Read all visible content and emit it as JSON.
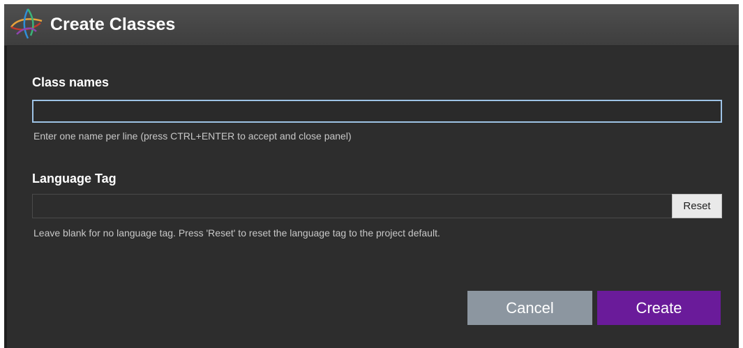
{
  "dialog": {
    "title": "Create Classes"
  },
  "class_names": {
    "label": "Class names",
    "value": "",
    "placeholder": "",
    "hint": "Enter one name per line (press CTRL+ENTER to accept and close panel)"
  },
  "language_tag": {
    "label": "Language Tag",
    "value": "",
    "placeholder": "",
    "reset_label": "Reset",
    "hint": "Leave blank for no language tag. Press 'Reset' to reset the language tag to the project default."
  },
  "actions": {
    "cancel_label": "Cancel",
    "create_label": "Create"
  },
  "colors": {
    "dialog_background": "#2d2d2d",
    "titlebar": "#464646",
    "focus_border": "#9ec3e6",
    "cancel_button": "#8c96a0",
    "create_button": "#6a1b9a"
  },
  "icons": {
    "app_logo": "protege-logo-icon"
  }
}
